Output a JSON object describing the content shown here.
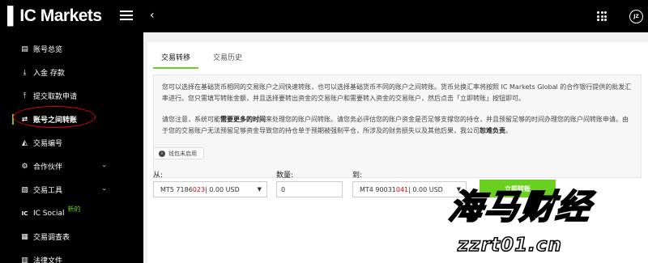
{
  "app": {
    "logo_text": "IC Markets"
  },
  "sidebar": {
    "items": [
      {
        "label": "账号总览",
        "icon": "chart-bar-icon"
      },
      {
        "label": "入金 存款",
        "icon": "download-icon"
      },
      {
        "label": "提交取款申请",
        "icon": "upload-icon"
      },
      {
        "label": "账号之间转账",
        "icon": "transfer-arrows-icon",
        "active": true
      },
      {
        "label": "交易编号",
        "icon": "line-chart-icon"
      },
      {
        "label": "合作伙伴",
        "icon": "handshake-icon",
        "expandable": true
      },
      {
        "label": "交易工具",
        "icon": "tools-icon",
        "expandable": true
      },
      {
        "label": "IC Social",
        "icon": "ic-social-icon",
        "badge": "新的"
      },
      {
        "label": "交易调查表",
        "icon": "survey-icon"
      },
      {
        "label": "法律文件",
        "icon": "document-icon"
      }
    ]
  },
  "header": {
    "avatar_initials": "JZ"
  },
  "main": {
    "tabs": [
      {
        "label": "交易转移",
        "active": true
      },
      {
        "label": "交易历史",
        "active": false
      }
    ],
    "info_p1": "您可以选择在基础货币相同的交易账户之间快速转账，也可以选择基础货币不同的账户之间转账。货币兑换汇率将按照 IC Markets Global 的合作银行提供的批发汇率进行。您只需填写转账金额，并且选择要转出资金的交易账户和需要转入资金的交易账户，然后点击「立即转账」按钮即可。",
    "info_p2_a": "请您注意，系统可能",
    "info_p2_bold": "需要更多的时间",
    "info_p2_b": "来处理您的账户间转账。请您务必评估您的账户资金是否足够支撑您的持仓，并且预留足够的时间办理您的账户间转账申请。由于您的交易账户无法预留足够资金导致您的持仓单于预期被强制平仓，所涉及的财务损失以及其他后果，我公司",
    "info_p2_bold2": "恕难负责",
    "info_p2_c": "。",
    "wallet_badge": "钱包未启用",
    "from_label": "从:",
    "from_value_a": "MT5 7186",
    "from_value_red": "023",
    "from_value_b": " | 0.00 USD",
    "amount_label": "数量:",
    "amount_value": "0",
    "to_label": "到:",
    "to_value_a": "MT4 90031",
    "to_value_red": "041",
    "to_value_b": " | 0.00 USD",
    "submit_label": "立即转账"
  },
  "watermark": {
    "title": "海马财经",
    "url": "zzrt01.cn"
  },
  "colors": {
    "accent": "#6ad01f",
    "sidebar_bg": "#000000",
    "annotation": "#e00000"
  }
}
